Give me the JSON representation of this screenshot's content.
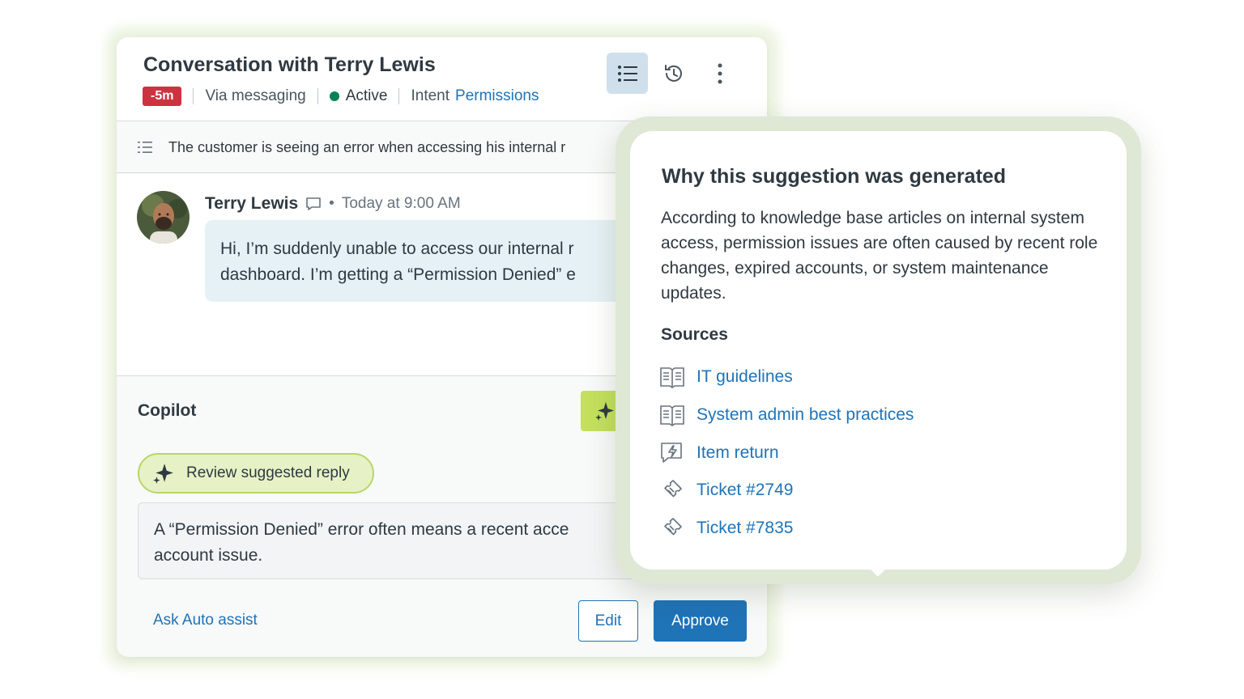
{
  "conversation": {
    "title": "Conversation with Terry Lewis",
    "badge": "-5m",
    "channel": "Via messaging",
    "status": "Active",
    "intent_label": "Intent",
    "intent_value": "Permissions",
    "summary": "The customer is seeing an error when accessing his internal r"
  },
  "message": {
    "sender": "Terry Lewis",
    "timestamp": "Today at 9:00 AM",
    "line1": "Hi, I’m suddenly unable to access our internal r",
    "line2": "dashboard. I’m getting a “Permission Denied” e"
  },
  "copilot": {
    "title": "Copilot",
    "review_label": "Review suggested reply",
    "reply_line1": "A “Permission Denied” error often means a recent acce",
    "reply_line2": "account issue.",
    "ask_link": "Ask Auto assist",
    "edit_label": "Edit",
    "approve_label": "Approve"
  },
  "popover": {
    "title": "Why this suggestion was generated",
    "body": "According to knowledge base articles on internal system access, permission issues are often caused by recent role changes, expired accounts, or system maintenance updates.",
    "sources_label": "Sources",
    "sources": [
      {
        "label": "IT guidelines",
        "icon": "book-icon"
      },
      {
        "label": "System admin best practices",
        "icon": "book-icon"
      },
      {
        "label": "Item return",
        "icon": "macro-bolt-icon"
      },
      {
        "label": "Ticket #2749",
        "icon": "ticket-icon"
      },
      {
        "label": "Ticket #7835",
        "icon": "ticket-icon"
      }
    ]
  },
  "colors": {
    "accent_blue": "#1f73b7",
    "badge_red": "#cc3340",
    "active_green": "#038153",
    "copilot_lime": "#c4e05d"
  }
}
